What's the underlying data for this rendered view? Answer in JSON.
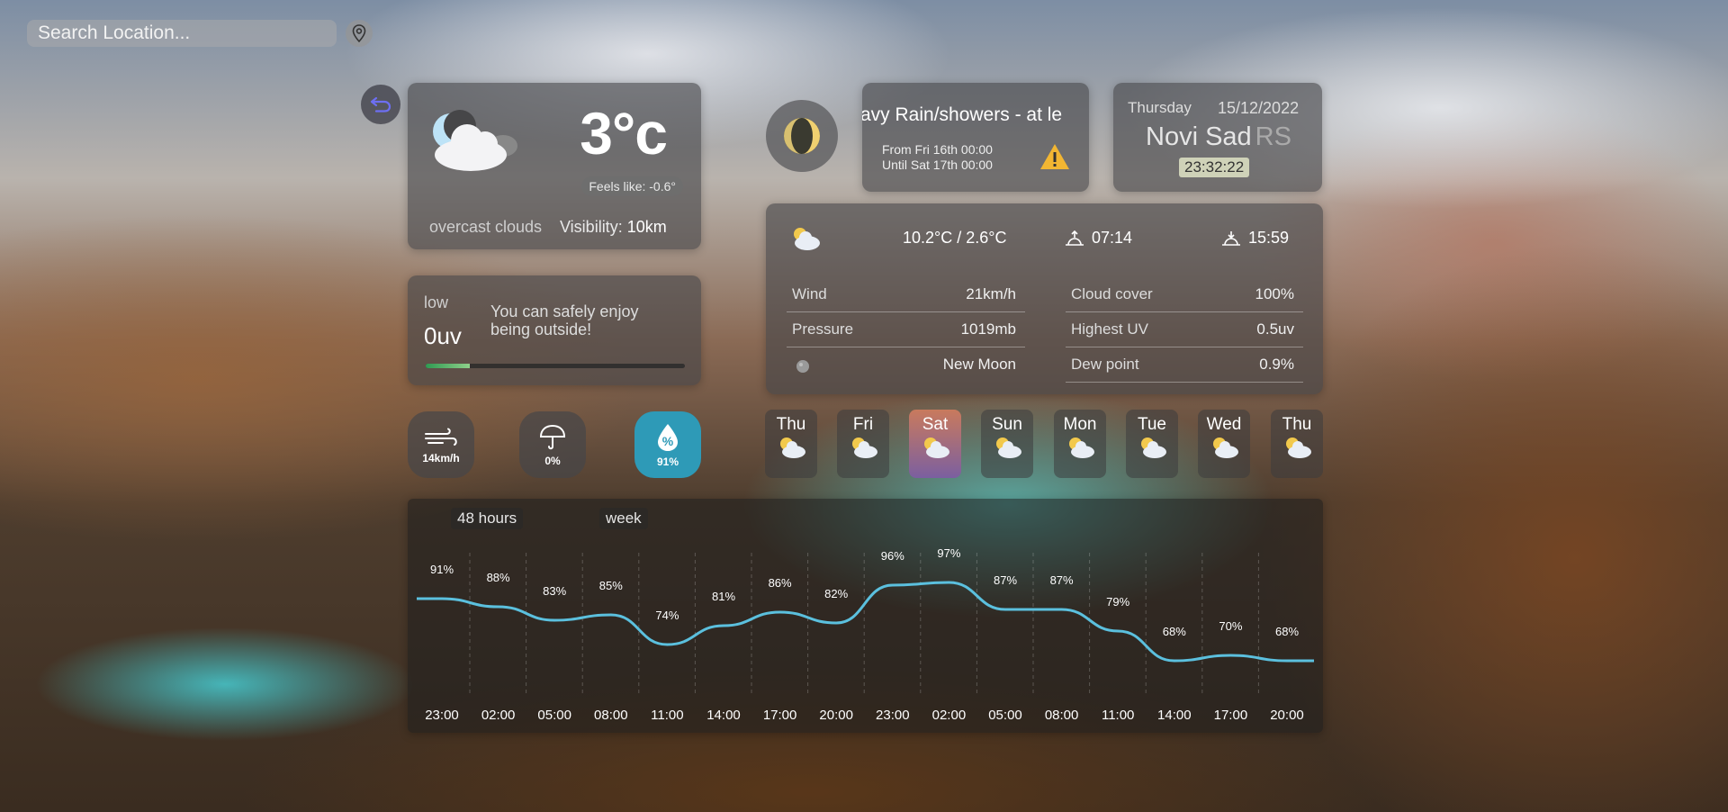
{
  "search": {
    "placeholder": "Search Location..."
  },
  "current": {
    "temp": "3°c",
    "feels_like": "Feels like: -0.6°",
    "description": "overcast clouds",
    "visibility_label": "Visibility:",
    "visibility_value": "10km"
  },
  "uv": {
    "level": "low",
    "value": "0uv",
    "message": "You can safely enjoy being outside!",
    "progress": 0.17
  },
  "stats": {
    "wind": "14km/h",
    "precip": "0%",
    "humidity": "91%"
  },
  "alert": {
    "title": "avy Rain/showers - at le",
    "from": "From Fri 16th 00:00",
    "until": "Until Sat 17th 00:00"
  },
  "date_box": {
    "day": "Thursday",
    "date": "15/12/2022",
    "city": "Novi Sad",
    "country": "RS",
    "time": "23:32:22"
  },
  "details": {
    "temp_range": "10.2°C / 2.6°C",
    "sunrise": "07:14",
    "sunset": "15:59",
    "left": [
      {
        "label": "Wind",
        "value": "21km/h"
      },
      {
        "label": "Pressure",
        "value": "1019mb"
      },
      {
        "label": "",
        "value": "New Moon"
      }
    ],
    "right": [
      {
        "label": "Cloud cover",
        "value": "100%"
      },
      {
        "label": "Highest UV",
        "value": "0.5uv"
      },
      {
        "label": "Dew point",
        "value": "0.9%"
      }
    ]
  },
  "week": [
    "Thu",
    "Fri",
    "Sat",
    "Sun",
    "Mon",
    "Tue",
    "Wed",
    "Thu"
  ],
  "week_active": 2,
  "graph_tabs": {
    "hours": "48 hours",
    "week": "week"
  },
  "chart_data": {
    "type": "line",
    "x": [
      "23:00",
      "02:00",
      "05:00",
      "08:00",
      "11:00",
      "14:00",
      "17:00",
      "20:00",
      "23:00",
      "02:00",
      "05:00",
      "08:00",
      "11:00",
      "14:00",
      "17:00",
      "20:00"
    ],
    "values": [
      91,
      88,
      83,
      85,
      74,
      81,
      86,
      82,
      96,
      97,
      87,
      87,
      79,
      68,
      70,
      68
    ],
    "labels": [
      "91%",
      "88%",
      "83%",
      "85%",
      "74%",
      "81%",
      "86%",
      "82%",
      "96%",
      "97%",
      "87%",
      "87%",
      "79%",
      "68%",
      "70%",
      "68%"
    ],
    "line_color": "#5bc0de",
    "grid": "vertical dashed"
  }
}
